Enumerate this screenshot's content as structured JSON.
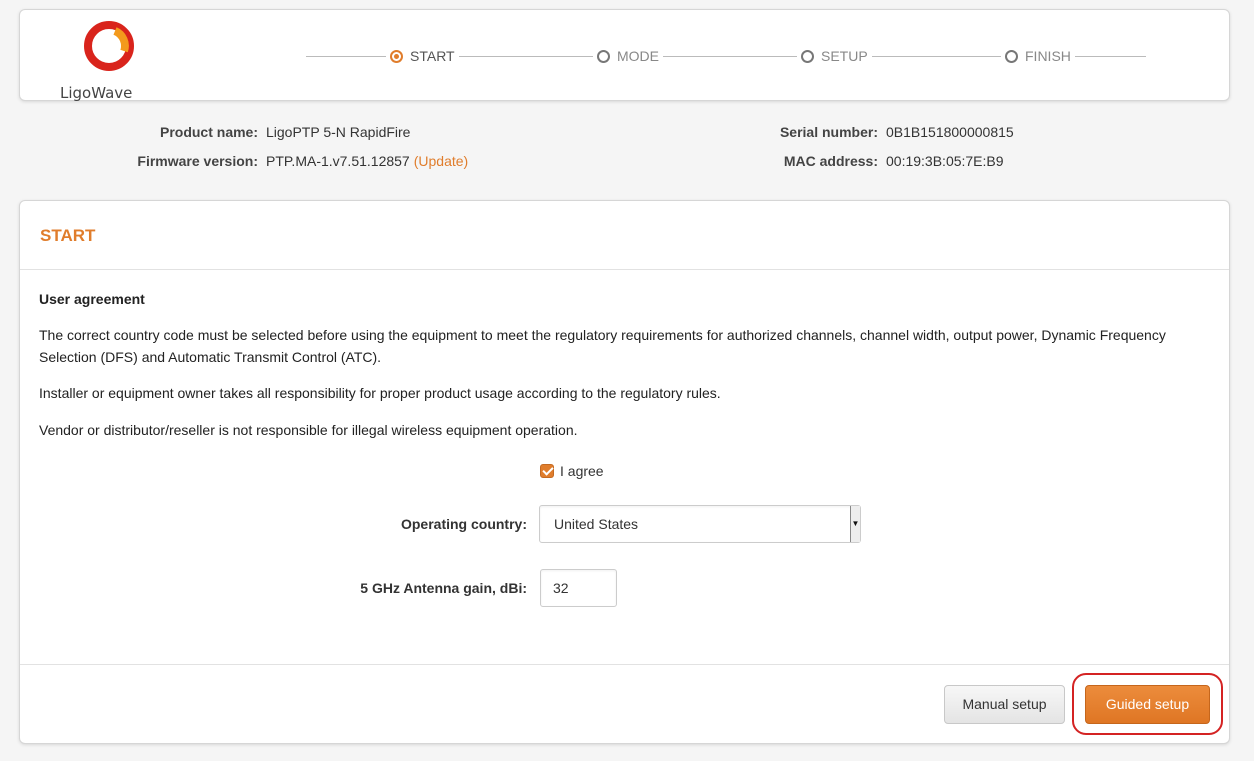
{
  "brand": {
    "name": "LigoWave",
    "accent_color": "#e07d2c",
    "logo_colors": [
      "#d9241c",
      "#f39a1d"
    ]
  },
  "wizard": {
    "steps": [
      {
        "label": "START",
        "active": true
      },
      {
        "label": "MODE",
        "active": false
      },
      {
        "label": "SETUP",
        "active": false
      },
      {
        "label": "FINISH",
        "active": false
      }
    ]
  },
  "device_info": {
    "product_name_label": "Product name:",
    "product_name": "LigoPTP 5-N RapidFire",
    "firmware_label": "Firmware version:",
    "firmware": "PTP.MA-1.v7.51.12857",
    "update_link": "(Update)",
    "serial_label": "Serial number:",
    "serial": "0B1B151800000815",
    "mac_label": "MAC address:",
    "mac": "00:19:3B:05:7E:B9"
  },
  "start_card": {
    "title": "START",
    "agreement_title": "User agreement",
    "paragraph_1": "The correct country code must be selected before using the equipment to meet the regulatory requirements for authorized channels, channel width, output power, Dynamic Frequency Selection (DFS) and Automatic Transmit Control (ATC).",
    "paragraph_2": "Installer or equipment owner takes all responsibility for proper product usage according to the regulatory rules.",
    "paragraph_3": "Vendor or distributor/reseller is not responsible for illegal wireless equipment operation.",
    "agree_label": "I agree",
    "agree_checked": true,
    "country_label": "Operating country:",
    "country_value": "United States",
    "antenna_label": "5 GHz Antenna gain, dBi:",
    "antenna_value": "32",
    "manual_button": "Manual setup",
    "guided_button": "Guided setup"
  }
}
